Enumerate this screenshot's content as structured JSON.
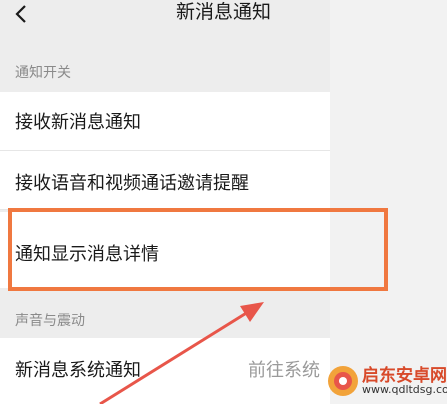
{
  "header": {
    "title": "新消息通知"
  },
  "sections": {
    "notify_switch": "通知开关",
    "sound_vibrate": "声音与震动"
  },
  "rows": {
    "receive_new": {
      "label": "接收新消息通知",
      "enabled": true
    },
    "voice_video": {
      "label": "接收语音和视频通话邀请提醒",
      "enabled": true
    },
    "show_detail": {
      "label": "通知显示消息详情",
      "enabled": true
    },
    "system_notify": {
      "label": "新消息系统通知",
      "value": "前往系统"
    }
  },
  "watermark": {
    "text": "启东安卓网",
    "url": "www.qdltdsg.com"
  },
  "colors": {
    "toggle_on": "#07c160",
    "highlight": "#f07840",
    "arrow": "#e8564a"
  }
}
